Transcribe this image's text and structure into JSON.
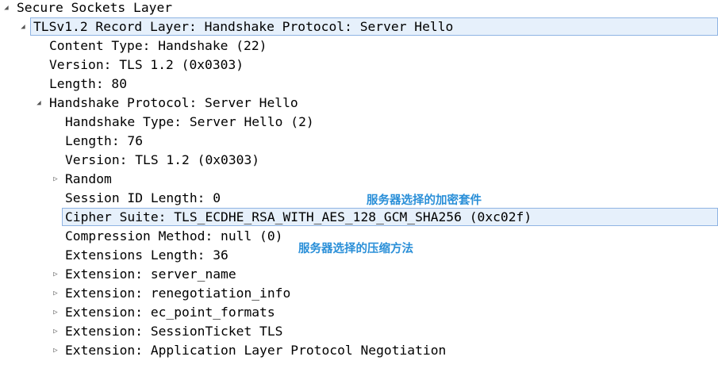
{
  "tree": {
    "ssl": {
      "label": "Secure Sockets Layer",
      "expanded": true
    },
    "record": {
      "label": "TLSv1.2 Record Layer: Handshake Protocol: Server Hello",
      "expanded": true,
      "selected": true
    },
    "content_type": {
      "label": "Content Type: Handshake (22)"
    },
    "version": {
      "label": "Version: TLS 1.2 (0x0303)"
    },
    "length": {
      "label": "Length: 80"
    },
    "handshake": {
      "label": "Handshake Protocol: Server Hello",
      "expanded": true
    },
    "handshake_type": {
      "label": "Handshake Type: Server Hello (2)"
    },
    "hs_length": {
      "label": "Length: 76"
    },
    "hs_version": {
      "label": "Version: TLS 1.2 (0x0303)"
    },
    "random": {
      "label": "Random",
      "expanded": false
    },
    "session_id_length": {
      "label": "Session ID Length: 0"
    },
    "cipher_suite": {
      "label": "Cipher Suite: TLS_ECDHE_RSA_WITH_AES_128_GCM_SHA256 (0xc02f)",
      "selected": true
    },
    "compression": {
      "label": "Compression Method: null (0)"
    },
    "extensions_length": {
      "label": "Extensions Length: 36"
    },
    "extensions": [
      {
        "label": "Extension: server_name",
        "expanded": false
      },
      {
        "label": "Extension: renegotiation_info",
        "expanded": false
      },
      {
        "label": "Extension: ec_point_formats",
        "expanded": false
      },
      {
        "label": "Extension: SessionTicket TLS",
        "expanded": false
      },
      {
        "label": "Extension: Application Layer Protocol Negotiation",
        "expanded": false
      }
    ]
  },
  "annotations": {
    "cipher_note": "服务器选择的加密套件",
    "compression_note": "服务器选择的压缩方法"
  },
  "icons": {
    "expanded": "◢",
    "collapsed": "▷"
  },
  "colors": {
    "selection_fill": "#e6f0fb",
    "selection_border": "#8fb4e3",
    "annotation_text": "#2a8fd8"
  }
}
